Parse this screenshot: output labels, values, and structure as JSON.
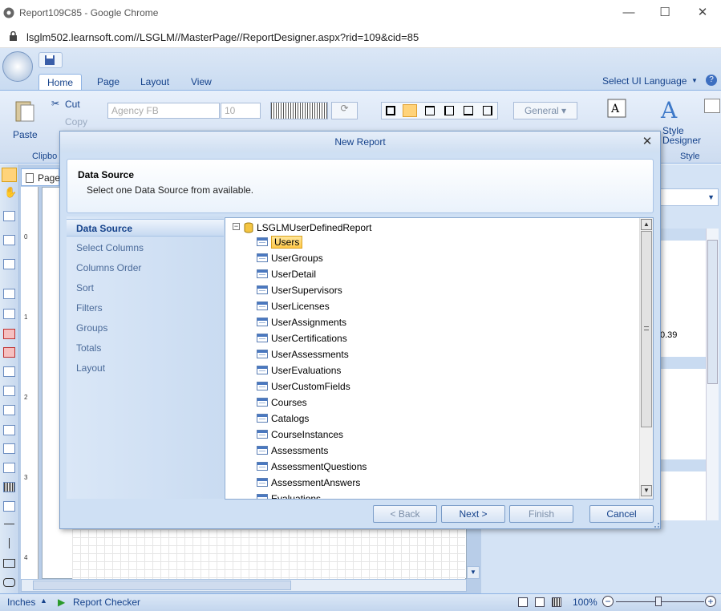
{
  "browser": {
    "title": "Report109C85 - Google Chrome",
    "url": "lsglm502.learnsoft.com//LSGLM//MasterPage//ReportDesigner.aspx?rid=109&cid=85"
  },
  "ribbon": {
    "tabs": [
      "Home",
      "Page",
      "Layout",
      "View"
    ],
    "active_tab": "Home",
    "ui_language": "Select UI Language",
    "clipboard": {
      "paste": "Paste",
      "cut": "Cut",
      "copy": "Copy",
      "group": "Clipbo"
    },
    "font_name": "Agency FB",
    "font_size": "10",
    "format": "General",
    "style_designer": "Style\nDesigner",
    "style_group": "Style"
  },
  "designer": {
    "page_tab": "Page",
    "ruler_marks": [
      "0",
      "1",
      "2",
      "3",
      "4"
    ],
    "right_value": "0.39"
  },
  "status": {
    "units": "Inches",
    "report_checker": "Report Checker",
    "zoom": "100%"
  },
  "dialog": {
    "title": "New Report",
    "header_title": "Data Source",
    "header_subtitle": "Select one Data Source from available.",
    "steps": [
      "Data Source",
      "Select Columns",
      "Columns Order",
      "Sort",
      "Filters",
      "Groups",
      "Totals",
      "Layout"
    ],
    "active_step": "Data Source",
    "tree": {
      "root": "LSGLMUserDefinedReport",
      "selected": "Users",
      "items": [
        "Users",
        "UserGroups",
        "UserDetail",
        "UserSupervisors",
        "UserLicenses",
        "UserAssignments",
        "UserCertifications",
        "UserAssessments",
        "UserEvaluations",
        "UserCustomFields",
        "Courses",
        "Catalogs",
        "CourseInstances",
        "Assessments",
        "AssessmentQuestions",
        "AssessmentAnswers",
        "Evaluations"
      ]
    },
    "buttons": {
      "back": "< Back",
      "next": "Next >",
      "finish": "Finish",
      "cancel": "Cancel"
    }
  }
}
